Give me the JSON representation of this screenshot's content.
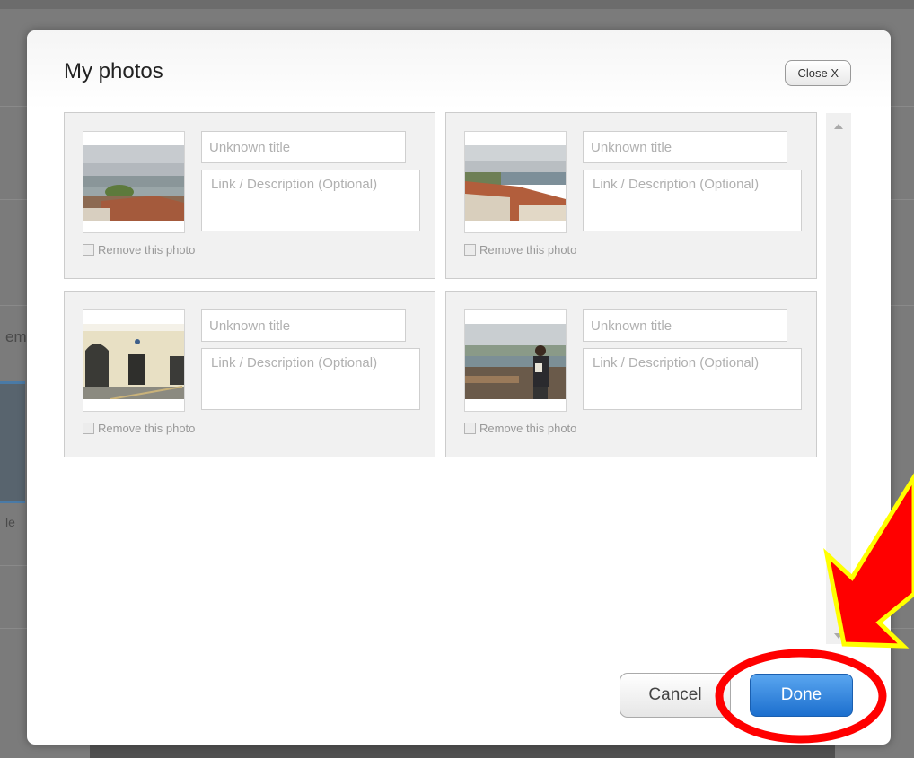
{
  "background": {
    "snippet_top": "em",
    "snippet_bottom": "le"
  },
  "modal": {
    "title": "My photos",
    "close_label": "Close X"
  },
  "photos": [
    {
      "title_placeholder": "Unknown title",
      "description_placeholder": "Link / Description (Optional)",
      "remove_label": "Remove this photo",
      "scene": "harbor-town"
    },
    {
      "title_placeholder": "Unknown title",
      "description_placeholder": "Link / Description (Optional)",
      "remove_label": "Remove this photo",
      "scene": "rooftops-river"
    },
    {
      "title_placeholder": "Unknown title",
      "description_placeholder": "Link / Description (Optional)",
      "remove_label": "Remove this photo",
      "scene": "building-facade"
    },
    {
      "title_placeholder": "Unknown title",
      "description_placeholder": "Link / Description (Optional)",
      "remove_label": "Remove this photo",
      "scene": "person-viewpoint"
    }
  ],
  "footer": {
    "cancel_label": "Cancel",
    "done_label": "Done"
  },
  "colors": {
    "done_button": "#1c6fce",
    "annotation_arrow": "#ff0000",
    "annotation_arrow_outline": "#ffff00",
    "annotation_circle": "#ff0000"
  }
}
